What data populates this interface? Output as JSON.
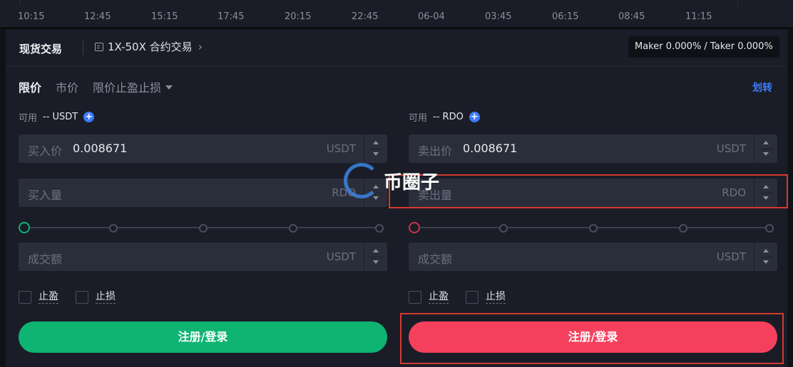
{
  "axis": {
    "ticks": [
      "10:15",
      "12:45",
      "15:15",
      "17:45",
      "20:15",
      "22:45",
      "06-04",
      "03:45",
      "06:15",
      "08:45",
      "11:15"
    ]
  },
  "header": {
    "spot_label": "现货交易",
    "futures_label": "1X-50X 合约交易",
    "fee_text": "Maker 0.000% / Taker 0.000%"
  },
  "order_tabs": {
    "limit": "限价",
    "market": "市价",
    "stop": "限价止盈止损"
  },
  "transfer_label": "划转",
  "buy": {
    "avail_label": "可用",
    "avail_value": "-- USDT",
    "price_label": "买入价",
    "price_value": "0.008671",
    "price_unit": "USDT",
    "qty_label": "买入量",
    "qty_unit": "RDO",
    "total_label": "成交额",
    "total_unit": "USDT",
    "take_profit": "止盈",
    "stop_loss": "止损",
    "button": "注册/登录",
    "slider_percent": 0
  },
  "sell": {
    "avail_label": "可用",
    "avail_value": "-- RDO",
    "price_label": "卖出价",
    "price_value": "0.008671",
    "price_unit": "USDT",
    "qty_label": "卖出量",
    "qty_unit": "RDO",
    "total_label": "成交额",
    "total_unit": "USDT",
    "take_profit": "止盈",
    "stop_loss": "止损",
    "button": "注册/登录",
    "slider_percent": 0
  },
  "watermark": {
    "text": "币圈子"
  },
  "colors": {
    "buy": "#0fb473",
    "sell": "#f5405d",
    "accent": "#3d7bff",
    "highlight": "#d63a2f"
  }
}
